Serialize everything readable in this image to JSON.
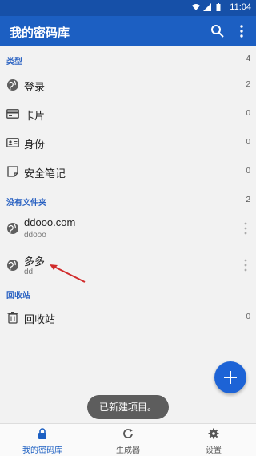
{
  "status_bar": {
    "time": "11:04"
  },
  "app_bar": {
    "title": "我的密码库"
  },
  "sections": {
    "types": {
      "label": "类型",
      "count": "4"
    },
    "no_folder": {
      "label": "没有文件夹",
      "count": "2"
    },
    "trash": {
      "label": "回收站"
    }
  },
  "type_rows": [
    {
      "label": "登录",
      "count": "2",
      "icon": "globe-icon"
    },
    {
      "label": "卡片",
      "count": "0",
      "icon": "card-icon"
    },
    {
      "label": "身份",
      "count": "0",
      "icon": "id-card-icon"
    },
    {
      "label": "安全笔记",
      "count": "0",
      "icon": "note-icon"
    }
  ],
  "items": [
    {
      "name": "ddooo.com",
      "username": "ddooo"
    },
    {
      "name": "多多",
      "username": "dd"
    }
  ],
  "trash_row": {
    "label": "回收站",
    "count": "0"
  },
  "toast": {
    "text": "已新建项目。"
  },
  "bottom_nav": [
    {
      "label": "我的密码库",
      "icon": "lock-icon",
      "active": true
    },
    {
      "label": "生成器",
      "icon": "refresh-icon",
      "active": false
    },
    {
      "label": "设置",
      "icon": "gear-icon",
      "active": false
    }
  ],
  "colors": {
    "primary": "#1c5fc2",
    "status_bar": "#1650a8",
    "accent_text": "#2a62c2",
    "fab": "#1d63d6"
  }
}
